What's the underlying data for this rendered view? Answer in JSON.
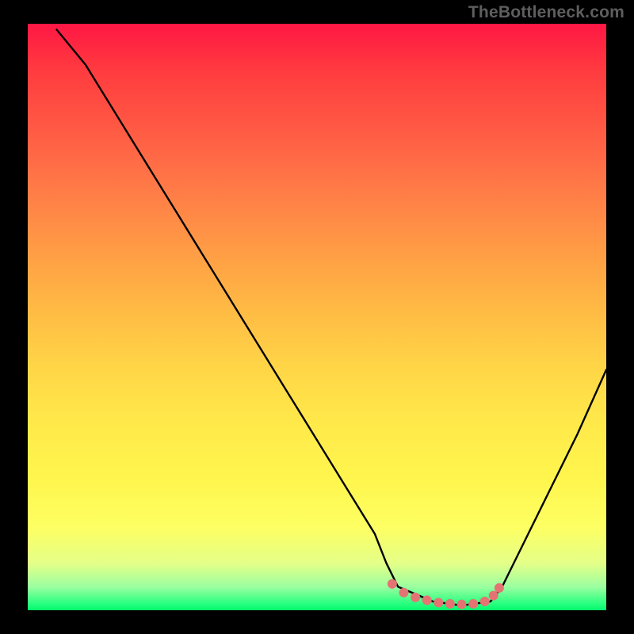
{
  "watermark": "TheBottleneck.com",
  "chart_data": {
    "type": "line",
    "title": "",
    "xlabel": "",
    "ylabel": "",
    "xlim": [
      0,
      100
    ],
    "ylim": [
      0,
      100
    ],
    "grid": false,
    "series": [
      {
        "name": "bottleneck-curve",
        "x": [
          5,
          10,
          15,
          20,
          25,
          30,
          35,
          40,
          45,
          50,
          55,
          60,
          62,
          64,
          70,
          75,
          80,
          82,
          85,
          90,
          95,
          100
        ],
        "y": [
          99,
          93,
          85,
          77,
          69,
          61,
          53,
          45,
          37,
          29,
          21,
          13,
          8,
          4,
          1.5,
          0.8,
          1.5,
          4,
          10,
          20,
          30,
          41
        ]
      }
    ],
    "markers": [
      {
        "name": "flat-region-dot",
        "x": 63,
        "y": 4.5
      },
      {
        "name": "flat-region-dot",
        "x": 65,
        "y": 3.0
      },
      {
        "name": "flat-region-dot",
        "x": 67,
        "y": 2.2
      },
      {
        "name": "flat-region-dot",
        "x": 69,
        "y": 1.7
      },
      {
        "name": "flat-region-dot",
        "x": 71,
        "y": 1.3
      },
      {
        "name": "flat-region-dot",
        "x": 73,
        "y": 1.1
      },
      {
        "name": "flat-region-dot",
        "x": 75,
        "y": 1.0
      },
      {
        "name": "flat-region-dot",
        "x": 77,
        "y": 1.1
      },
      {
        "name": "flat-region-dot",
        "x": 79,
        "y": 1.5
      },
      {
        "name": "flat-region-dot",
        "x": 80.5,
        "y": 2.5
      },
      {
        "name": "flat-region-dot",
        "x": 81.5,
        "y": 3.8
      }
    ],
    "marker_color": "#e57373",
    "marker_radius_px": 6
  }
}
